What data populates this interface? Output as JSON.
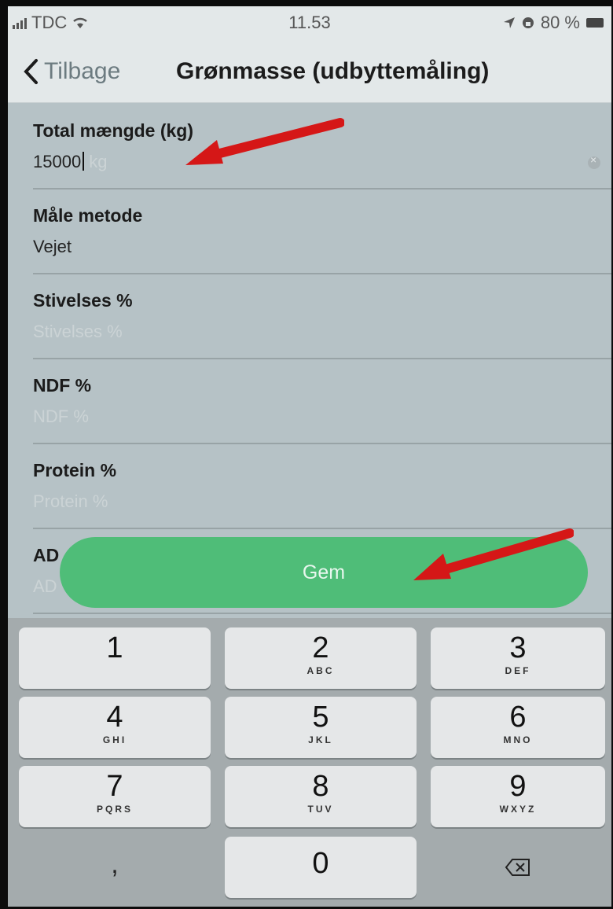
{
  "status_bar": {
    "carrier": "TDC",
    "time": "11.53",
    "battery": "80 %"
  },
  "nav": {
    "back_label": "Tilbage",
    "title": "Grønmasse (udbyttemåling)"
  },
  "fields": [
    {
      "label": "Total mængde (kg)",
      "value": "15000",
      "unit": "kg",
      "placeholder": ""
    },
    {
      "label": "Måle metode",
      "value": "Vejet",
      "unit": "",
      "placeholder": ""
    },
    {
      "label": "Stivelses %",
      "value": "",
      "unit": "",
      "placeholder": "Stivelses %"
    },
    {
      "label": "NDF %",
      "value": "",
      "unit": "",
      "placeholder": "NDF %"
    },
    {
      "label": "Protein %",
      "value": "",
      "unit": "",
      "placeholder": "Protein %"
    },
    {
      "label": "AD",
      "value": "",
      "unit": "",
      "placeholder": "AD"
    }
  ],
  "save_button": {
    "label": "Gem",
    "color": "#4fbd78"
  },
  "keyboard": {
    "keys": [
      {
        "digit": "1",
        "letters": ""
      },
      {
        "digit": "2",
        "letters": "ABC"
      },
      {
        "digit": "3",
        "letters": "DEF"
      },
      {
        "digit": "4",
        "letters": "GHI"
      },
      {
        "digit": "5",
        "letters": "JKL"
      },
      {
        "digit": "6",
        "letters": "MNO"
      },
      {
        "digit": "7",
        "letters": "PQRS"
      },
      {
        "digit": "8",
        "letters": "TUV"
      },
      {
        "digit": "9",
        "letters": "WXYZ"
      },
      {
        "digit": "0",
        "letters": ""
      }
    ],
    "comma_label": ","
  },
  "annotation_color": "#d51717"
}
